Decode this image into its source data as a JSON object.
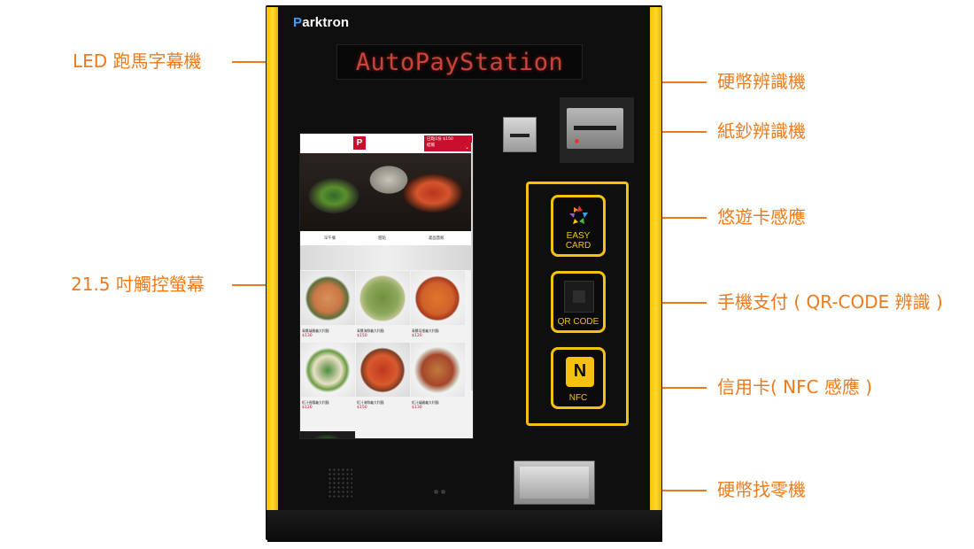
{
  "brand": {
    "logo_prefix": "P",
    "logo_rest": "arktron"
  },
  "led_display": {
    "text": "AutoPayStation"
  },
  "callouts": {
    "led": "LED 跑馬字幕機",
    "screen": "21.5 吋觸控螢幕",
    "coin_acceptor": "硬幣辨識機",
    "bill_acceptor": "紙鈔辨識機",
    "easycard": "悠遊卡感應",
    "qrcode": "手機支付 ( QR-CODE 辨識 )",
    "nfc": "信用卡( NFC 感應 )",
    "coin_change": "硬幣找零機"
  },
  "payment_buttons": {
    "easycard": "EASY CARD",
    "qrcode": "QR CODE",
    "nfc": "NFC",
    "nfc_mark": "N"
  },
  "screen": {
    "logo": "P",
    "cart_line1": "已點1份 $150",
    "cart_line2": "結帳",
    "cart_chevron": "⌄",
    "tabs": [
      "早午餐",
      "甜點",
      "義面蓋飯"
    ],
    "dishes": [
      {
        "name": "青醬燻雞義大利麵",
        "price": "$130"
      },
      {
        "name": "青醬海鮮義大利麵",
        "price": "$150"
      },
      {
        "name": "青醬培根義大利麵",
        "price": "$120"
      },
      {
        "name": "紅汁香腸義大利麵",
        "price": "$120"
      },
      {
        "name": "紅汁海鮮義大利麵",
        "price": "$150"
      },
      {
        "name": "紅汁燻雞義大利麵",
        "price": "$130"
      }
    ]
  },
  "colors": {
    "callout": "#ee7a1c",
    "accent_yellow": "#f4c20d",
    "brand_red": "#c8102e",
    "led_red": "#c9433c"
  }
}
